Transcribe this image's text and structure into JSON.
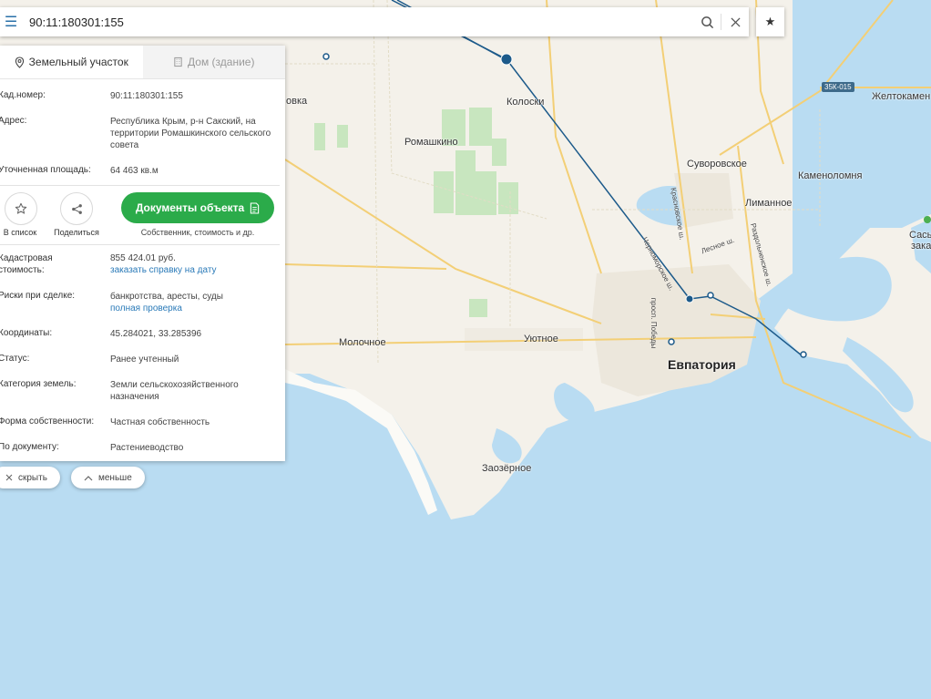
{
  "search": {
    "value": "90:11:180301:155"
  },
  "panel": {
    "tabs": [
      {
        "label": "Земельный участок",
        "active": true
      },
      {
        "label": "Дом (здание)",
        "active": false
      }
    ],
    "fields": [
      {
        "label": "Кад.номер:",
        "value": "90:11:180301:155",
        "link": true
      },
      {
        "label": "Адрес:",
        "value": "Республика Крым, р-н Сакский, на территории Ромашкинского сельского совета"
      },
      {
        "label": "Уточненная площадь:",
        "value": "64 463 кв.м"
      }
    ],
    "actions": {
      "save_label": "В список",
      "share_label": "Поделиться",
      "docs_label": "Документы объекта",
      "docs_sub": "Собственник, стоимость и др."
    },
    "details": [
      {
        "label": "Кадастровая стоимость:",
        "value": "855 424.01 руб.",
        "link_text": "заказать справку на дату"
      },
      {
        "label": "Риски при сделке:",
        "value": "банкротства, аресты, суды",
        "link_text": "полная проверка"
      },
      {
        "label": "Координаты:",
        "value": "45.284021, 33.285396"
      },
      {
        "label": "Статус:",
        "value": "Ранее учтенный"
      },
      {
        "label": "Категория земель:",
        "value": "Земли сельскохозяйственного назначения"
      },
      {
        "label": "Форма собственности:",
        "value": "Частная собственность"
      },
      {
        "label": "По документу:",
        "value": "Растениеводство"
      }
    ]
  },
  "pills": {
    "hide_label": "скрыть",
    "less_label": "меньше"
  },
  "map": {
    "places": [
      "Колоски",
      "Ромашкино",
      "Суворовское",
      "Каменоломня",
      "Лиманное",
      "Желтокамен",
      "Молочное",
      "Уютное",
      "Евпатория",
      "Заозёрное",
      "овка",
      "Сасы",
      "зака"
    ],
    "roads": [
      "Черноморское ш.",
      "просп. Победы",
      "Красновское ш.",
      "Лесное ш.",
      "Раздольненское ш."
    ],
    "shield": "35К-015"
  },
  "colors": {
    "accent": "#2a7ab8",
    "docs_button": "#2bab4a",
    "sea": "#b9dcf2",
    "land": "#f4f1ea"
  }
}
